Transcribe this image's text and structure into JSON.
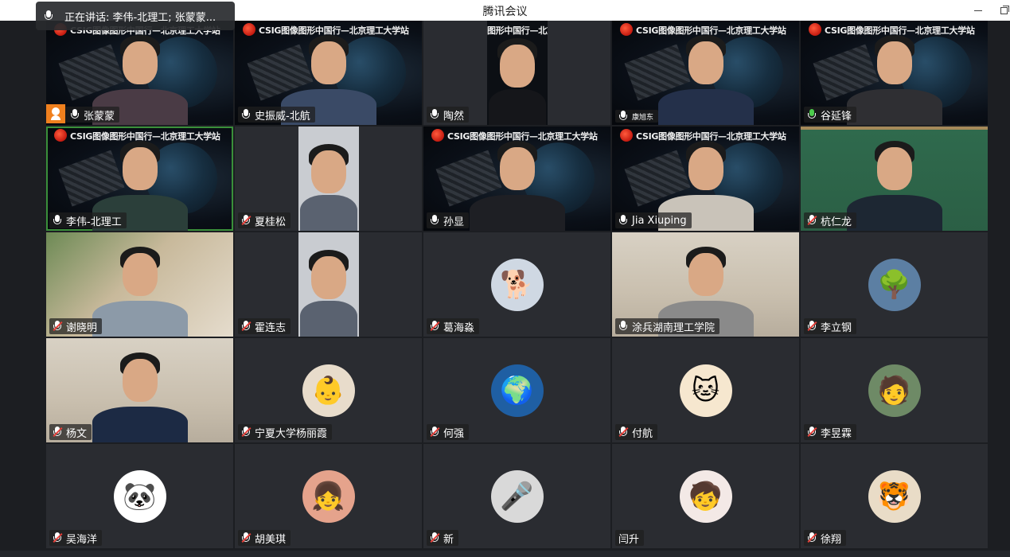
{
  "window": {
    "title": "腾讯会议"
  },
  "speaking_indicator": {
    "text": "正在讲话: 李伟-北理工; 张蒙蒙..."
  },
  "banner": {
    "text": "CSIG图像图形中国行—北京理工大学站",
    "text_partial_1": "图形中国行—北京"
  },
  "participants": [
    {
      "name": "张蒙蒙",
      "mic": "on",
      "host": true,
      "video": "banner-person",
      "banner": true
    },
    {
      "name": "史振威-北航",
      "mic": "on",
      "video": "banner-person",
      "banner": true
    },
    {
      "name": "陶然",
      "mic": "on",
      "video": "narrow-person"
    },
    {
      "name": "康旭东",
      "mic": "on",
      "video": "banner-person",
      "banner": true,
      "small": true
    },
    {
      "name": "谷延锋",
      "mic": "green",
      "video": "banner-person",
      "banner": true
    },
    {
      "name": "李伟-北理工",
      "mic": "on",
      "video": "banner-person",
      "banner": true,
      "active": true
    },
    {
      "name": "夏桂松",
      "mic": "muted",
      "video": "narrow-person"
    },
    {
      "name": "孙显",
      "mic": "on",
      "video": "banner-person",
      "banner": true
    },
    {
      "name": "Jia Xiuping",
      "mic": "on",
      "video": "banner-person",
      "banner": true
    },
    {
      "name": "杭仁龙",
      "mic": "muted",
      "video": "board-person"
    },
    {
      "name": "谢晓明",
      "mic": "muted",
      "video": "warm-person"
    },
    {
      "name": "霍连志",
      "mic": "muted",
      "video": "narrow-person"
    },
    {
      "name": "葛海淼",
      "mic": "muted",
      "avatar": "dog-icon",
      "avatar_bg": "#cfd8e3"
    },
    {
      "name": "涂兵湖南理工学院",
      "mic": "on",
      "video": "room-person"
    },
    {
      "name": "李立钢",
      "mic": "muted",
      "avatar": "lake-icon",
      "avatar_bg": "#5c7fa3"
    },
    {
      "name": "杨文",
      "mic": "muted",
      "video": "room-person"
    },
    {
      "name": "宁夏大学杨丽霞",
      "mic": "muted",
      "avatar": "baby-icon",
      "avatar_bg": "#e8dccb"
    },
    {
      "name": "何强",
      "mic": "muted",
      "avatar": "earth-icon",
      "avatar_bg": "#1f5fa3"
    },
    {
      "name": "付航",
      "mic": "muted",
      "avatar": "cat-icon",
      "avatar_bg": "#f6e7cf"
    },
    {
      "name": "李昱霖",
      "mic": "muted",
      "avatar": "anime-icon",
      "avatar_bg": "#6e8a66"
    },
    {
      "name": "吴海洋",
      "mic": "muted",
      "avatar": "panda-icon",
      "avatar_bg": "#ffffff"
    },
    {
      "name": "胡美琪",
      "mic": "muted",
      "avatar": "girl-icon",
      "avatar_bg": "#e5a38c"
    },
    {
      "name": "新",
      "mic": "muted",
      "avatar": "singer-icon",
      "avatar_bg": "#d9d9d9"
    },
    {
      "name": "闫升",
      "mic": "none",
      "avatar": "kid-icon",
      "avatar_bg": "#f3e9e6"
    },
    {
      "name": "徐翔",
      "mic": "muted",
      "avatar": "tiger-icon",
      "avatar_bg": "#e9dcc7"
    }
  ]
}
